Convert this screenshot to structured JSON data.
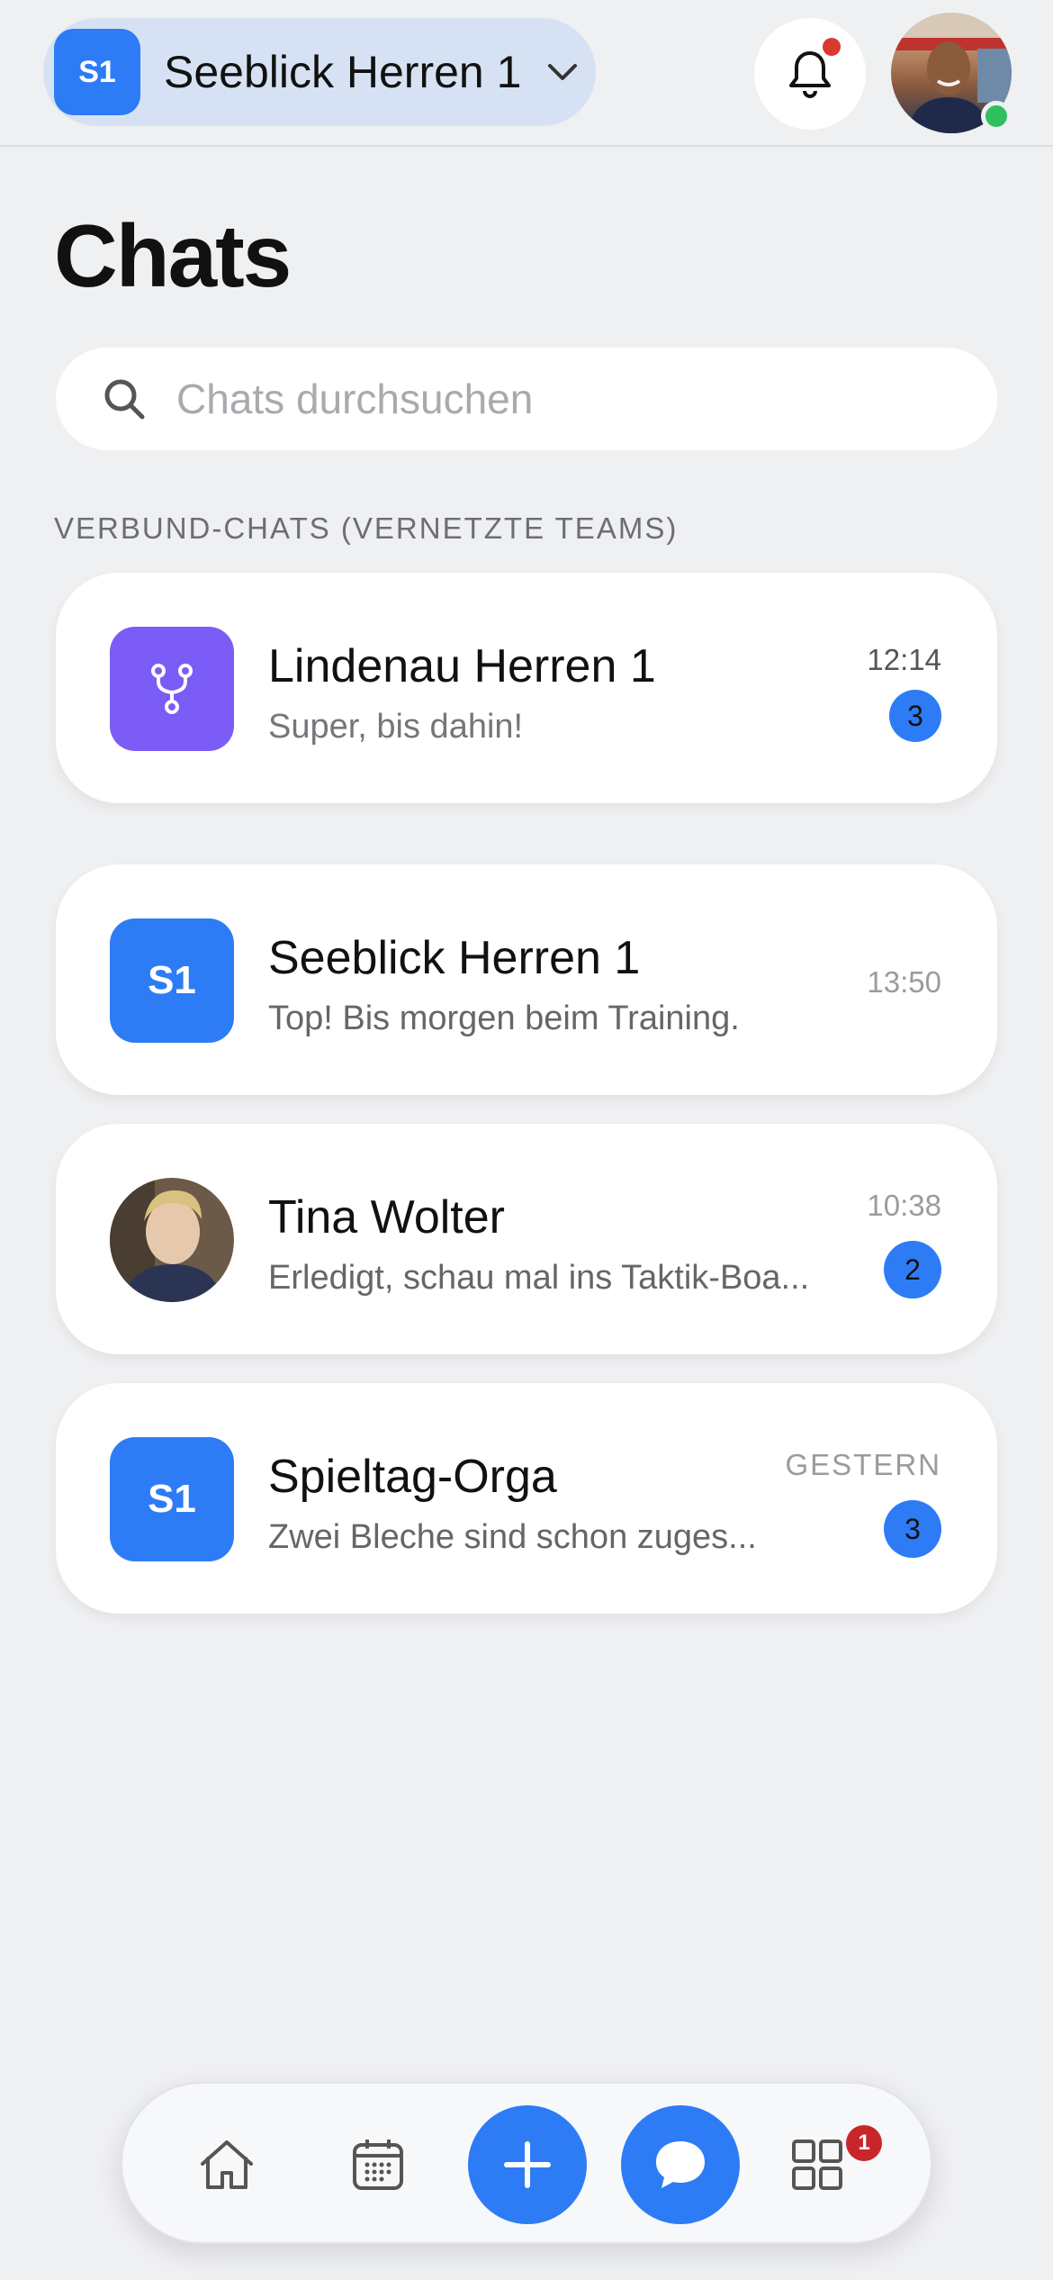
{
  "header": {
    "team_badge": "S1",
    "team_name": "Seeblick Herren 1",
    "icons": {
      "dropdown": "chevron-down-icon",
      "notifications": "bell-icon"
    },
    "has_notification_dot": true,
    "user_online": true
  },
  "page_title": "Chats",
  "search": {
    "placeholder": "Chats durchsuchen",
    "value": ""
  },
  "section_label": "VERBUND-CHATS (VERNETZTE TEAMS)",
  "chats": [
    {
      "name": "Lindenau Herren 1",
      "last_message": "Super, bis dahin!",
      "time": "12:14",
      "unread": "3",
      "avatar_icon": "network-fork-icon",
      "avatar_color": "#7c5cf6"
    },
    {
      "name": "Seeblick Herren 1",
      "last_message": "Top! Bis morgen beim Training.",
      "time": "13:50",
      "unread": "",
      "avatar_text": "S1",
      "avatar_color": "#2d7cf6"
    },
    {
      "name": "Tina Wolter",
      "last_message": "Erledigt, schau mal ins Taktik-Boa...",
      "time": "10:38",
      "unread": "2",
      "avatar_icon": "person-photo"
    },
    {
      "name": "Spieltag-Orga",
      "last_message": "Zwei Bleche sind schon zuges...",
      "time": "GESTERN",
      "unread": "3",
      "avatar_text": "S1",
      "avatar_color": "#2d7cf6"
    }
  ],
  "tabbar": {
    "items": [
      "home-icon",
      "calendar-icon",
      "plus-icon",
      "chat-bubble-icon",
      "grid-icon"
    ],
    "active": "chat-bubble-icon",
    "grid_badge": "1"
  },
  "colors": {
    "accent": "#2d7cf6",
    "purple": "#7c5cf6",
    "badge_red": "#c8262b",
    "online_green": "#31c05d"
  }
}
